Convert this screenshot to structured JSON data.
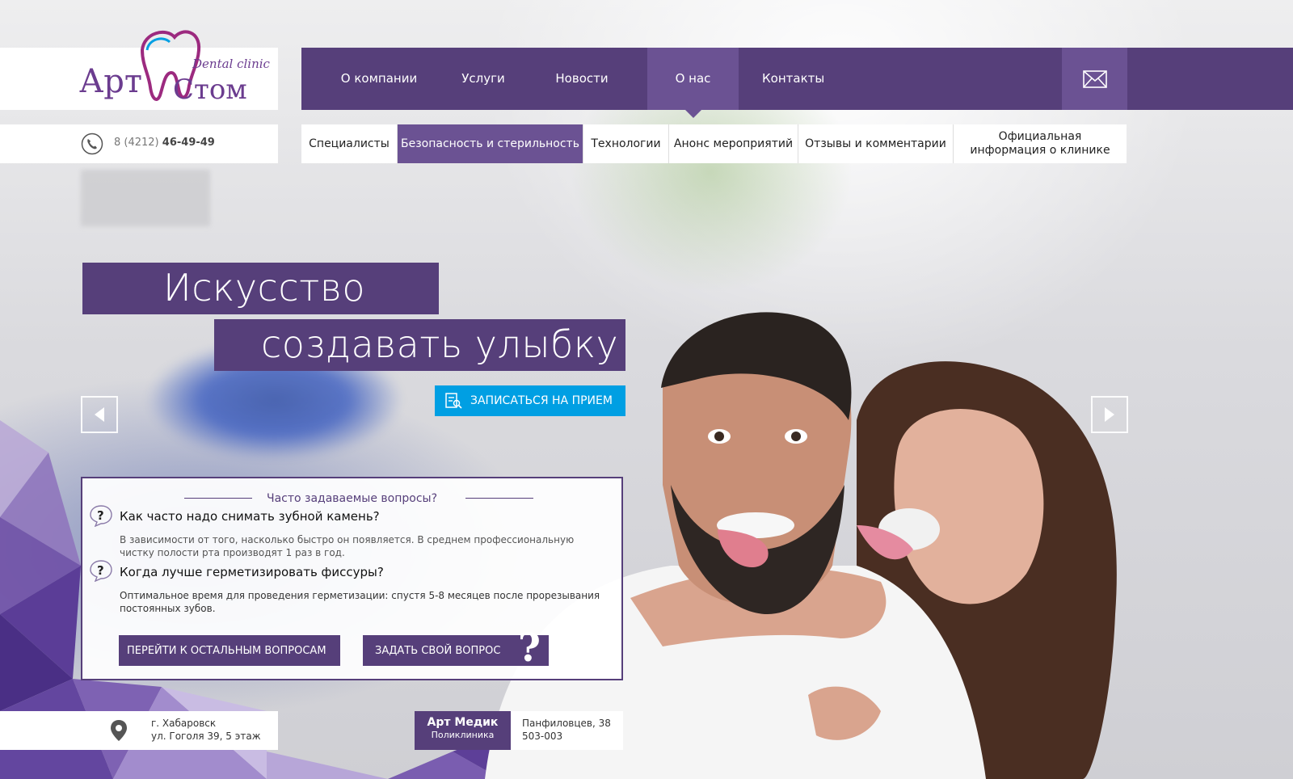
{
  "brand": {
    "logo_word1": "Арт",
    "logo_word2": "Стом",
    "logo_tagline": "Dental clinic"
  },
  "nav": {
    "items": [
      {
        "label": "О компании"
      },
      {
        "label": "Услуги"
      },
      {
        "label": "Новости"
      },
      {
        "label": "О нас",
        "active": true
      },
      {
        "label": "Контакты"
      }
    ],
    "mail_icon": "envelope-icon"
  },
  "phone": {
    "code": "8 (4212)",
    "number": "46-49-49",
    "icon": "phone-icon"
  },
  "subnav": {
    "items": [
      {
        "label": "Специалисты"
      },
      {
        "label": "Безопасность и стерильность",
        "active": true
      },
      {
        "label": "Технологии"
      },
      {
        "label": "Анонс мероприятий"
      },
      {
        "label": "Отзывы и комментарии"
      },
      {
        "label": "Официальная информация о клинике"
      }
    ]
  },
  "hero": {
    "line1": "Искусство",
    "line2": "создавать улыбку",
    "cta_label": "ЗАПИСАТЬСЯ НА ПРИЕМ",
    "cta_icon": "appointment-icon",
    "prev_icon": "arrow-left-icon",
    "next_icon": "arrow-right-icon"
  },
  "faq": {
    "title": "Часто задаваемые вопросы?",
    "items": [
      {
        "question": "Как часто надо снимать зубной камень?",
        "answer": "В зависимости от того, насколько быстро он появляется. В среднем профессиональную чистку полости рта производят 1 раз в год."
      },
      {
        "question": "Когда лучше герметизировать фиссуры?",
        "answer": "Оптимальное время для проведения герметизации: спустя 5-8 месяцев после прорезывания постоянных зубов."
      }
    ],
    "all_questions_label": "ПЕРЕЙТИ К ОСТАЛЬНЫМ ВОПРОСАМ",
    "ask_label": "ЗАДАТЬ СВОЙ ВОПРОС",
    "ask_mark": "?"
  },
  "address": {
    "city": "г. Хабаровск",
    "street": "ул. Гоголя 39, 5 этаж",
    "icon": "map-pin-icon"
  },
  "partner": {
    "name": "Арт Медик",
    "type": "Поликлиника",
    "street": "Панфиловцев, 38",
    "phone": "503-003"
  },
  "colors": {
    "brand_purple": "#563f7a",
    "active_purple": "#6b5293",
    "cta_blue": "#009fe3"
  }
}
